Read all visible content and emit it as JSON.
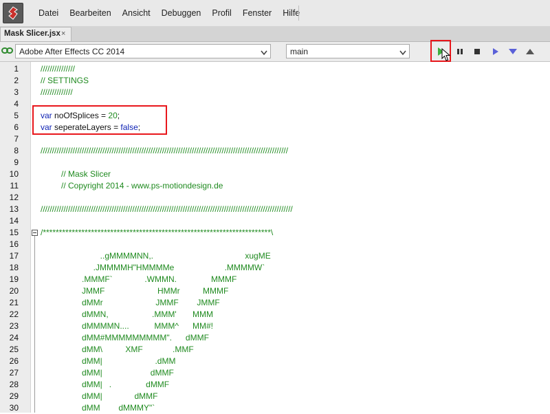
{
  "menu": {
    "items": [
      "Datei",
      "Bearbeiten",
      "Ansicht",
      "Debuggen",
      "Profil",
      "Fenster",
      "Hilfe"
    ]
  },
  "tabs": [
    {
      "label": "Mask Slicer.jsx",
      "close": "×"
    }
  ],
  "toolbar": {
    "target_app": "Adobe After Effects CC 2014",
    "engine": "main",
    "buttons": [
      "run-icon",
      "pause-icon",
      "stop-icon",
      "step-over-icon",
      "step-into-icon",
      "step-out-icon"
    ],
    "highlighted_button": "run-icon"
  },
  "editor": {
    "line_numbers": [
      "1",
      "2",
      "3",
      "4",
      "5",
      "6",
      "7",
      "8",
      "9",
      "10",
      "11",
      "12",
      "13",
      "14",
      "15",
      "16",
      "17",
      "18",
      "19",
      "20",
      "21",
      "22",
      "23",
      "24",
      "25",
      "26",
      "27",
      "28",
      "29",
      "30"
    ],
    "lines": [
      "///////////////",
      "// SETTINGS",
      "//////////////",
      "",
      "var noOfSplices = 20;",
      "var seperateLayers = false;",
      "",
      "////////////////////////////////////////////////////////////////////////////////////////////////////////////",
      "",
      "         // Mask Slicer",
      "         // Copyright 2014 - www.ps-motiondesign.de",
      "",
      "//////////////////////////////////////////////////////////////////////////////////////////////////////////////",
      "",
      "/***********************************************************************\\",
      "",
      "                          ..gMMMMNN,.                                        xugME",
      "                       .JMMMMH\"HMMMMe                      .MMMMW`",
      "                  .MMMF`              .WMMN.               MMMF",
      "                  JMMF                       HMMr          MMMF",
      "                  dMMr                       JMMF        JMMF",
      "                  dMMN,                   .MMM'       MMM",
      "                  dMMMMN....           MMM^      MM#!",
      "                  dMM#MMMMMMMMM\".      dMMF",
      "                  dMM\\          XMF             .MMF",
      "                  dMM|                       .dMM",
      "                  dMM|                     dMMF",
      "                  dMM|   .               dMMF",
      "                  dMM|              dMMF",
      "                  dMM        dMMMY\"`"
    ],
    "code_tokens": {
      "line5": {
        "kw": "var",
        "name": "noOfSplices",
        "op": " = ",
        "value": "20",
        "end": ";"
      },
      "line6": {
        "kw": "var",
        "name": "seperateLayers",
        "op": " = ",
        "value": "false",
        "end": ";"
      }
    },
    "fold_line": "15",
    "highlighted_lines": [
      "5",
      "6"
    ]
  },
  "colors": {
    "comment": "#1f8a1f",
    "keyword": "#0b1fb3",
    "highlight_box": "#e8161b",
    "gutter": "#ececec",
    "menubar": "#e9e9e9"
  }
}
